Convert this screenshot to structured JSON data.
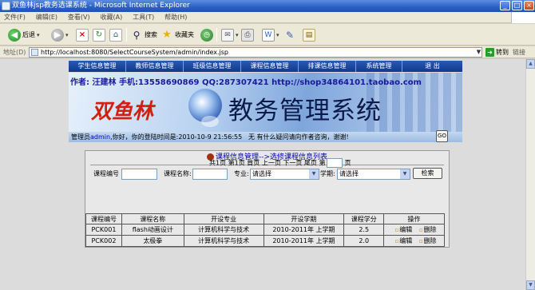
{
  "window": {
    "title": "双鱼林jsp教务选课系统 - Microsoft Internet Explorer",
    "minimize": "_",
    "maximize": "□",
    "close": "×"
  },
  "menu": [
    "文件(F)",
    "编辑(E)",
    "查看(V)",
    "收藏(A)",
    "工具(T)",
    "帮助(H)"
  ],
  "toolbar": {
    "back": "后退",
    "search": "搜索",
    "favorites": "收藏夹"
  },
  "address": {
    "label": "地址(D)",
    "url": "http://localhost:8080/SelectCourseSystem/admin/index.jsp",
    "go": "转到",
    "links": "链接"
  },
  "site_nav": [
    "学生信息管理",
    "教师信息管理",
    "班级信息管理",
    "课程信息管理",
    "排课信息管理",
    "系统管理",
    "退 出"
  ],
  "banner": {
    "author_line": "作者: 汪建林  手机:13558690869 QQ:287307421 http://shop34864101.taobao.com",
    "brand": "双鱼林",
    "system_title": "教务管理系统"
  },
  "welcome": {
    "prefix": "管理员",
    "user": "admin",
    "suffix": ",你好，你的登陆时间是:2010-10-9 21:56:55",
    "notice": "无 有什么疑问请向作者咨询，谢谢!"
  },
  "panel": {
    "title": "课程信息管理-->选修课程信息列表",
    "filters": {
      "course_no_label": "课程编号",
      "course_name_label": "课程名称:",
      "major_label": "专业:",
      "major_value": "请选择",
      "term_label": "学期:",
      "term_value": "请选择",
      "search_button": "检索"
    },
    "pager": {
      "total": "共1页",
      "current": "第1页",
      "first": "首页",
      "prev": "上一页",
      "next": "下一页",
      "last": "尾页",
      "goto_prefix": "第",
      "goto_suffix": "页",
      "go_button": "GO"
    }
  },
  "table": {
    "headers": [
      "课程编号",
      "课程名称",
      "开设专业",
      "开设学期",
      "课程学分",
      "操作"
    ],
    "rows": [
      {
        "no": "PCK001",
        "name": "flash动画设计",
        "major": "计算机科学与技术",
        "term": "2010-2011年 上学期",
        "credit": "2.5",
        "edit": "编辑",
        "delete": "删除"
      },
      {
        "no": "PCK002",
        "name": "太极拳",
        "major": "计算机科学与技术",
        "term": "2010-2011年 上学期",
        "credit": "2.0",
        "edit": "编辑",
        "delete": "删除"
      }
    ]
  }
}
